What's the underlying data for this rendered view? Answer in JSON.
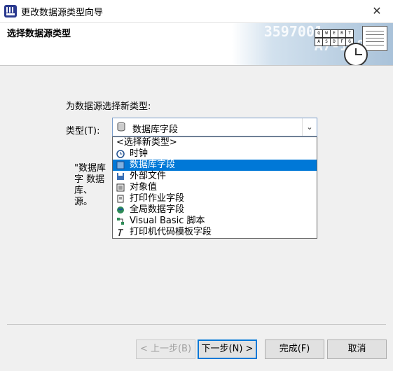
{
  "window": {
    "title": "更改数据源类型向导",
    "close_glyph": "✕"
  },
  "header": {
    "title": "选择数据源类型"
  },
  "banner": {
    "digits_top": "3597001",
    "digits_mid": "A7-118",
    "keys_row1": [
      "Q",
      "W",
      "E",
      "R",
      "T"
    ],
    "keys_row2": [
      "A",
      "S",
      "D",
      "F",
      "G"
    ]
  },
  "content": {
    "prompt": "为数据源选择新类型:",
    "type_label": "类型(T):",
    "combo_value": "数据库字段",
    "description": "\"数据库字 数据库、 源。"
  },
  "dropdown": {
    "options": [
      {
        "label": "<选择新类型>",
        "icon": "none"
      },
      {
        "label": "时钟",
        "icon": "clock-icon"
      },
      {
        "label": "数据库字段",
        "icon": "database-field-icon",
        "selected": true
      },
      {
        "label": "外部文件",
        "icon": "save-disk-icon"
      },
      {
        "label": "对象值",
        "icon": "object-value-icon"
      },
      {
        "label": "打印作业字段",
        "icon": "print-job-icon"
      },
      {
        "label": "全局数据字段",
        "icon": "globe-icon"
      },
      {
        "label": "Visual Basic 脚本",
        "icon": "vb-script-icon"
      },
      {
        "label": "打印机代码模板字段",
        "icon": "printer-code-template-icon"
      }
    ]
  },
  "buttons": {
    "back": "< 上一步(B)",
    "next": "下一步(N) >",
    "finish": "完成(F)",
    "cancel": "取消"
  },
  "colors": {
    "selection": "#0078d7",
    "window_bg": "#f0f0f0"
  }
}
